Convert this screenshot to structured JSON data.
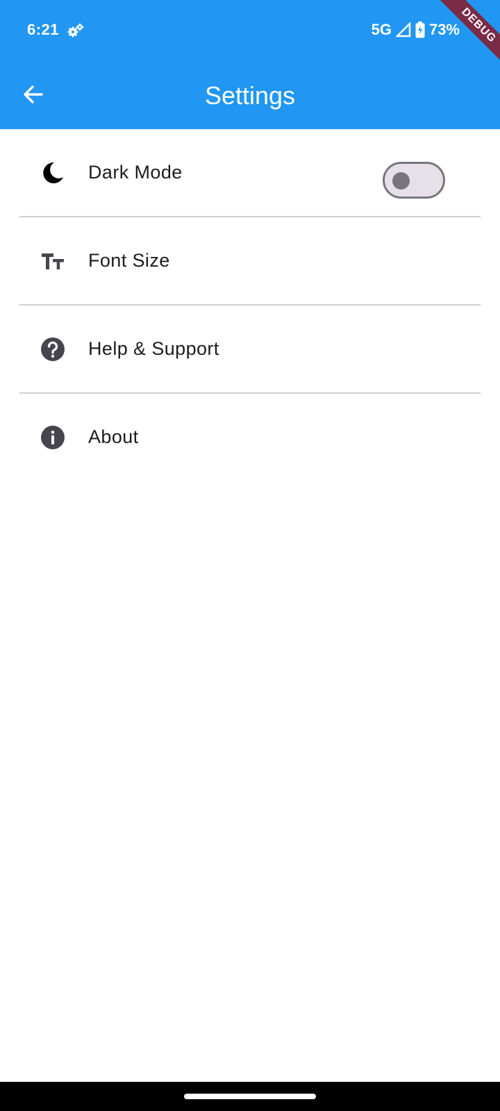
{
  "status_bar": {
    "time": "6:21",
    "network": "5G",
    "battery": "73%",
    "gear_icon": "gear-icon",
    "signal_icon": "signal-icon",
    "battery_icon": "battery-charging-icon"
  },
  "app_bar": {
    "title": "Settings",
    "back_icon": "arrow-back-icon",
    "color": "#2196F3"
  },
  "debug_banner": {
    "label": "DEBUG",
    "color": "#7a2b45"
  },
  "settings": {
    "items": [
      {
        "label": "Dark Mode",
        "icon": "moon-icon",
        "toggle": {
          "checked": false
        }
      },
      {
        "label": "Font Size",
        "icon": "text-size-icon"
      },
      {
        "label": "Help & Support",
        "icon": "help-icon"
      },
      {
        "label": "About",
        "icon": "info-icon"
      }
    ]
  }
}
